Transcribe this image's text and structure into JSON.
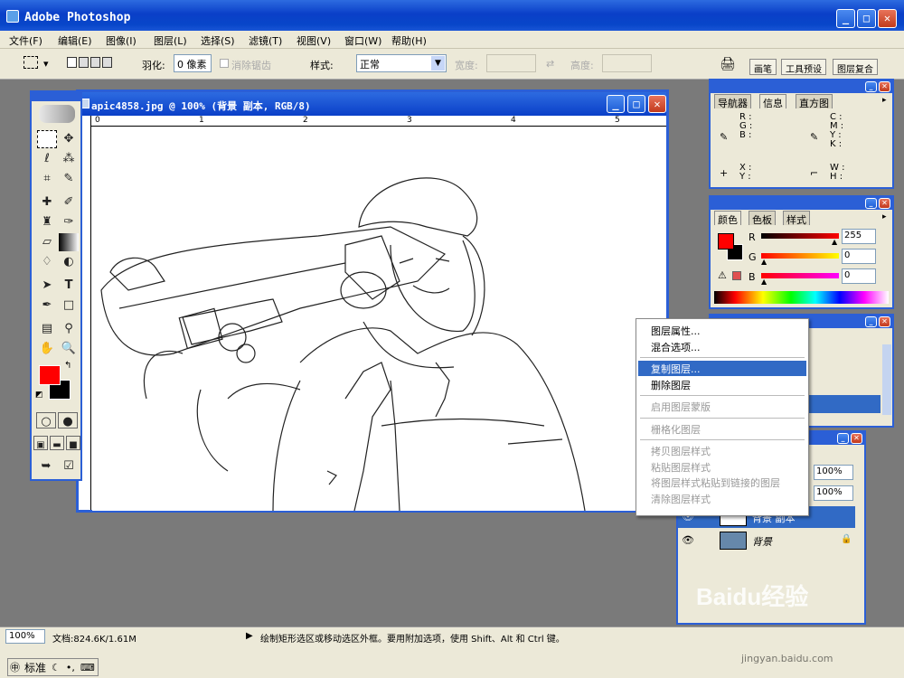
{
  "app": {
    "title": "Adobe Photoshop"
  },
  "menu": [
    "文件(F)",
    "编辑(E)",
    "图像(I)",
    "图层(L)",
    "选择(S)",
    "滤镜(T)",
    "视图(V)",
    "窗口(W)",
    "帮助(H)"
  ],
  "options": {
    "feather_label": "羽化:",
    "feather_value": "0 像素",
    "antialias_label": "消除锯齿",
    "style_label": "样式:",
    "style_value": "正常",
    "width_label": "宽度:",
    "height_label": "高度:",
    "tabs": [
      "画笔",
      "工具预设",
      "图层复合"
    ]
  },
  "document": {
    "title": "apic4858.jpg @ 100% (背景 副本, RGB/8)",
    "ruler_marks": [
      "0",
      "1",
      "2",
      "3",
      "4",
      "5"
    ]
  },
  "info_panel": {
    "tabs": [
      "导航器",
      "信息",
      "直方图"
    ],
    "rgb": [
      "R :",
      "G :",
      "B :"
    ],
    "cmyk": [
      "C :",
      "M :",
      "Y :",
      "K :"
    ],
    "xy": [
      "X :",
      "Y :"
    ],
    "wh": [
      "W :",
      "H :"
    ]
  },
  "color_panel": {
    "tabs": [
      "颜色",
      "色板",
      "样式"
    ],
    "channels": [
      {
        "label": "R",
        "value": "255",
        "level": 1.0
      },
      {
        "label": "G",
        "value": "0",
        "level": 0
      },
      {
        "label": "B",
        "value": "0",
        "level": 0
      }
    ],
    "foreground": "#ff0000"
  },
  "layers_panel": {
    "opacity": "100%",
    "fill": "100%",
    "layers": [
      {
        "name": "背景 副本",
        "selected": true
      },
      {
        "name": "背景",
        "selected": false
      }
    ]
  },
  "context_menu": {
    "items": [
      {
        "label": "图层属性...",
        "state": "normal"
      },
      {
        "label": "混合选项...",
        "state": "normal"
      },
      {
        "label": "sep"
      },
      {
        "label": "复制图层...",
        "state": "highlight"
      },
      {
        "label": "删除图层",
        "state": "normal"
      },
      {
        "label": "sep"
      },
      {
        "label": "启用图层蒙版",
        "state": "disabled"
      },
      {
        "label": "sep"
      },
      {
        "label": "栅格化图层",
        "state": "disabled"
      },
      {
        "label": "sep"
      },
      {
        "label": "拷贝图层样式",
        "state": "disabled"
      },
      {
        "label": "粘贴图层样式",
        "state": "disabled"
      },
      {
        "label": "将图层样式粘贴到链接的图层",
        "state": "disabled"
      },
      {
        "label": "清除图层样式",
        "state": "disabled"
      }
    ]
  },
  "status": {
    "zoom": "100%",
    "doc": "文档:824.6K/1.61M",
    "hint": "绘制矩形选区或移动选区外框。要用附加选项，使用 Shift、Alt 和 Ctrl 键。"
  },
  "taskbar": {
    "ime_label": "标准"
  },
  "watermark": {
    "brand": "Baidu经验",
    "url": "jingyan.baidu.com"
  }
}
